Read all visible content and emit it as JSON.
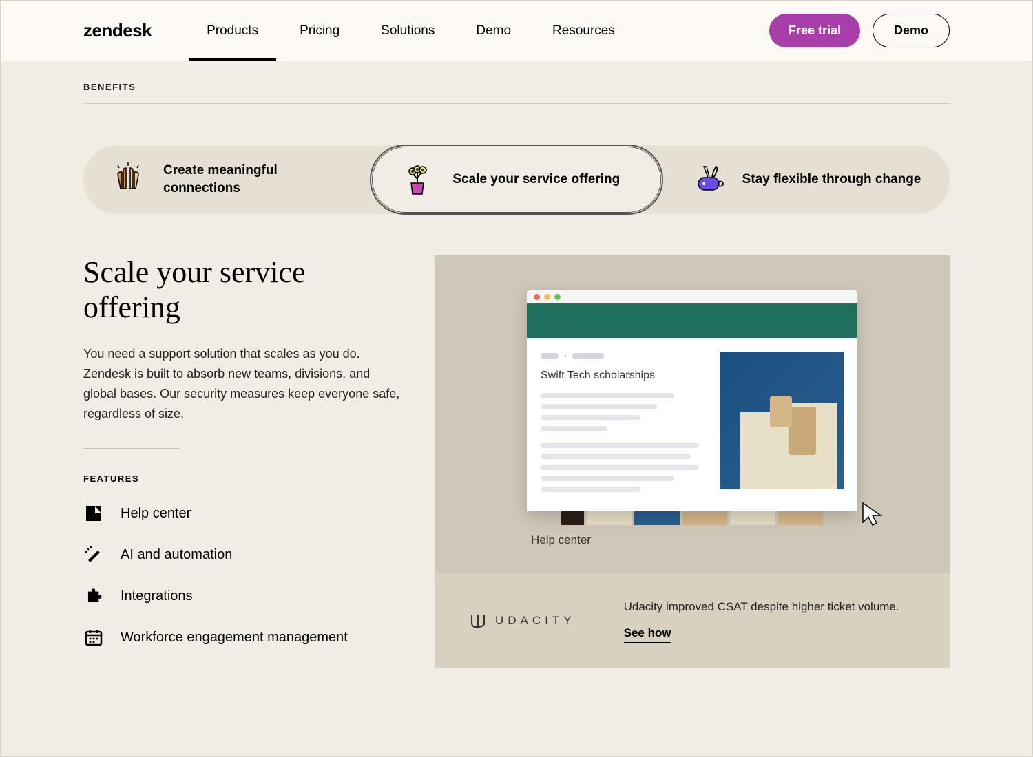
{
  "header": {
    "logo": "zendesk",
    "nav": [
      "Products",
      "Pricing",
      "Solutions",
      "Demo",
      "Resources"
    ],
    "cta_primary": "Free trial",
    "cta_secondary": "Demo"
  },
  "section_label": "BENEFITS",
  "pills": [
    {
      "label": "Create meaningful connections"
    },
    {
      "label": "Scale your service offering"
    },
    {
      "label": "Stay flexible through change"
    }
  ],
  "heading": "Scale your service offering",
  "body": "You need a support solution that scales as you do. Zendesk is built to absorb new teams, divisions, and global bases. Our security measures keep everyone safe, regardless of size.",
  "features_label": "FEATURES",
  "features": [
    "Help center",
    "AI and automation",
    "Integrations",
    "Workforce engagement management"
  ],
  "mockup": {
    "article_title": "Swift Tech scholarships",
    "caption": "Help center"
  },
  "callout": {
    "logo": "UDACITY",
    "desc": "Udacity improved CSAT despite higher ticket volume.",
    "link": "See how"
  }
}
